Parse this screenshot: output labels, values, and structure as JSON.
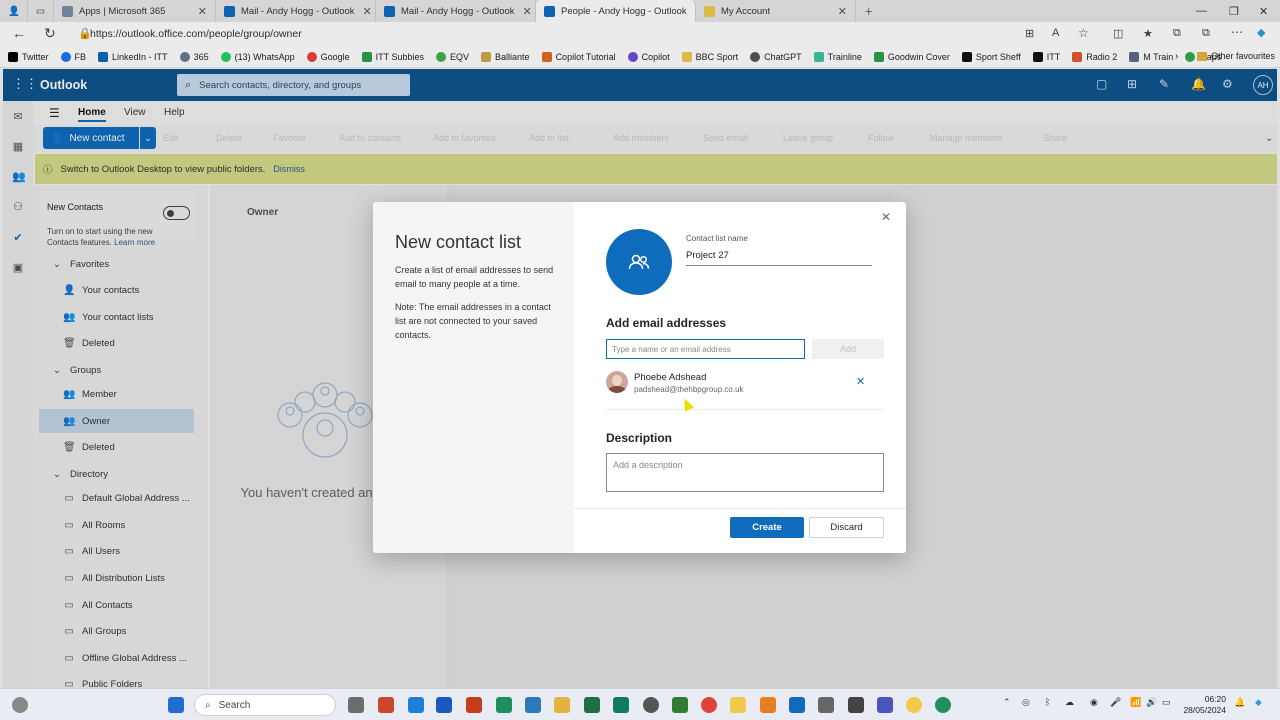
{
  "browser": {
    "tabs": [
      {
        "label": "Apps | Microsoft 365",
        "color": "#7b8fa8"
      },
      {
        "label": "Mail - Andy Hogg - Outlook",
        "color": "#0f6cbd"
      },
      {
        "label": "Mail - Andy Hogg - Outlook",
        "color": "#0f6cbd"
      },
      {
        "label": "People - Andy Hogg - Outlook",
        "color": "#0f6cbd"
      },
      {
        "label": "My Account",
        "color": "#f2c94c"
      }
    ],
    "url": "https://outlook.office.com/people/group/owner",
    "bookmarks": [
      "Twitter",
      "FB",
      "LinkedIn - ITT",
      "365",
      "(13) WhatsApp",
      "Google",
      "ITT Subbies",
      "EQV",
      "Balliante",
      "Copilot Tutorial",
      "Copilot",
      "BBC Sport",
      "ChatGPT",
      "Trainline",
      "Goodwin Cover",
      "Sport Sheff",
      "ITT",
      "Radio 2",
      "M Train",
      "Maps"
    ],
    "other_favourites": "Other favourites"
  },
  "outlook": {
    "app_name": "Outlook",
    "search_placeholder": "Search contacts, directory, and groups",
    "avatar_initials": "AH",
    "ribbon_tabs": [
      "Home",
      "View",
      "Help"
    ],
    "new_contact": "New contact",
    "ribbon_commands": [
      "Edit",
      "Delete",
      "Favorite",
      "Add to contacts",
      "Add to favorites",
      "Add to list",
      "Add members",
      "Send email",
      "Leave group",
      "Follow",
      "Manage members",
      "Share"
    ],
    "notice_text": "Switch to Outlook Desktop to view public folders.",
    "notice_dismiss": "Dismiss",
    "new_contacts_title": "New Contacts",
    "new_contacts_desc": "Turn on to start using the new Contacts features.",
    "learn_more": "Learn more",
    "nav": {
      "favorites": "Favorites",
      "your_contacts": "Your contacts",
      "your_contact_lists": "Your contact lists",
      "deleted": "Deleted",
      "groups": "Groups",
      "member": "Member",
      "owner": "Owner",
      "groups_deleted": "Deleted",
      "directory": "Directory",
      "dir_items": [
        "Default Global Address ...",
        "All Rooms",
        "All Users",
        "All Distribution Lists",
        "All Contacts",
        "All Groups",
        "Offline Global Address ...",
        "Public Folders"
      ]
    },
    "owner_header": "Owner",
    "empty_message": "You haven't created any groups yet"
  },
  "dialog": {
    "title": "New contact list",
    "desc1": "Create a list of email addresses to send email to many people at a time.",
    "desc2": "Note: The email addresses in a contact list are not connected to your saved contacts.",
    "name_label": "Contact list name",
    "name_value": "Project 27",
    "add_heading": "Add email addresses",
    "email_placeholder": "Type a name or an email address",
    "add_label": "Add",
    "member_name": "Phoebe Adshead",
    "member_email": "padshead@thehbpgroup.co.uk",
    "desc_heading": "Description",
    "desc_placeholder": "Add a description",
    "create_label": "Create",
    "discard_label": "Discard"
  },
  "taskbar": {
    "search": "Search",
    "time": "06:20",
    "date": "28/05/2024"
  }
}
